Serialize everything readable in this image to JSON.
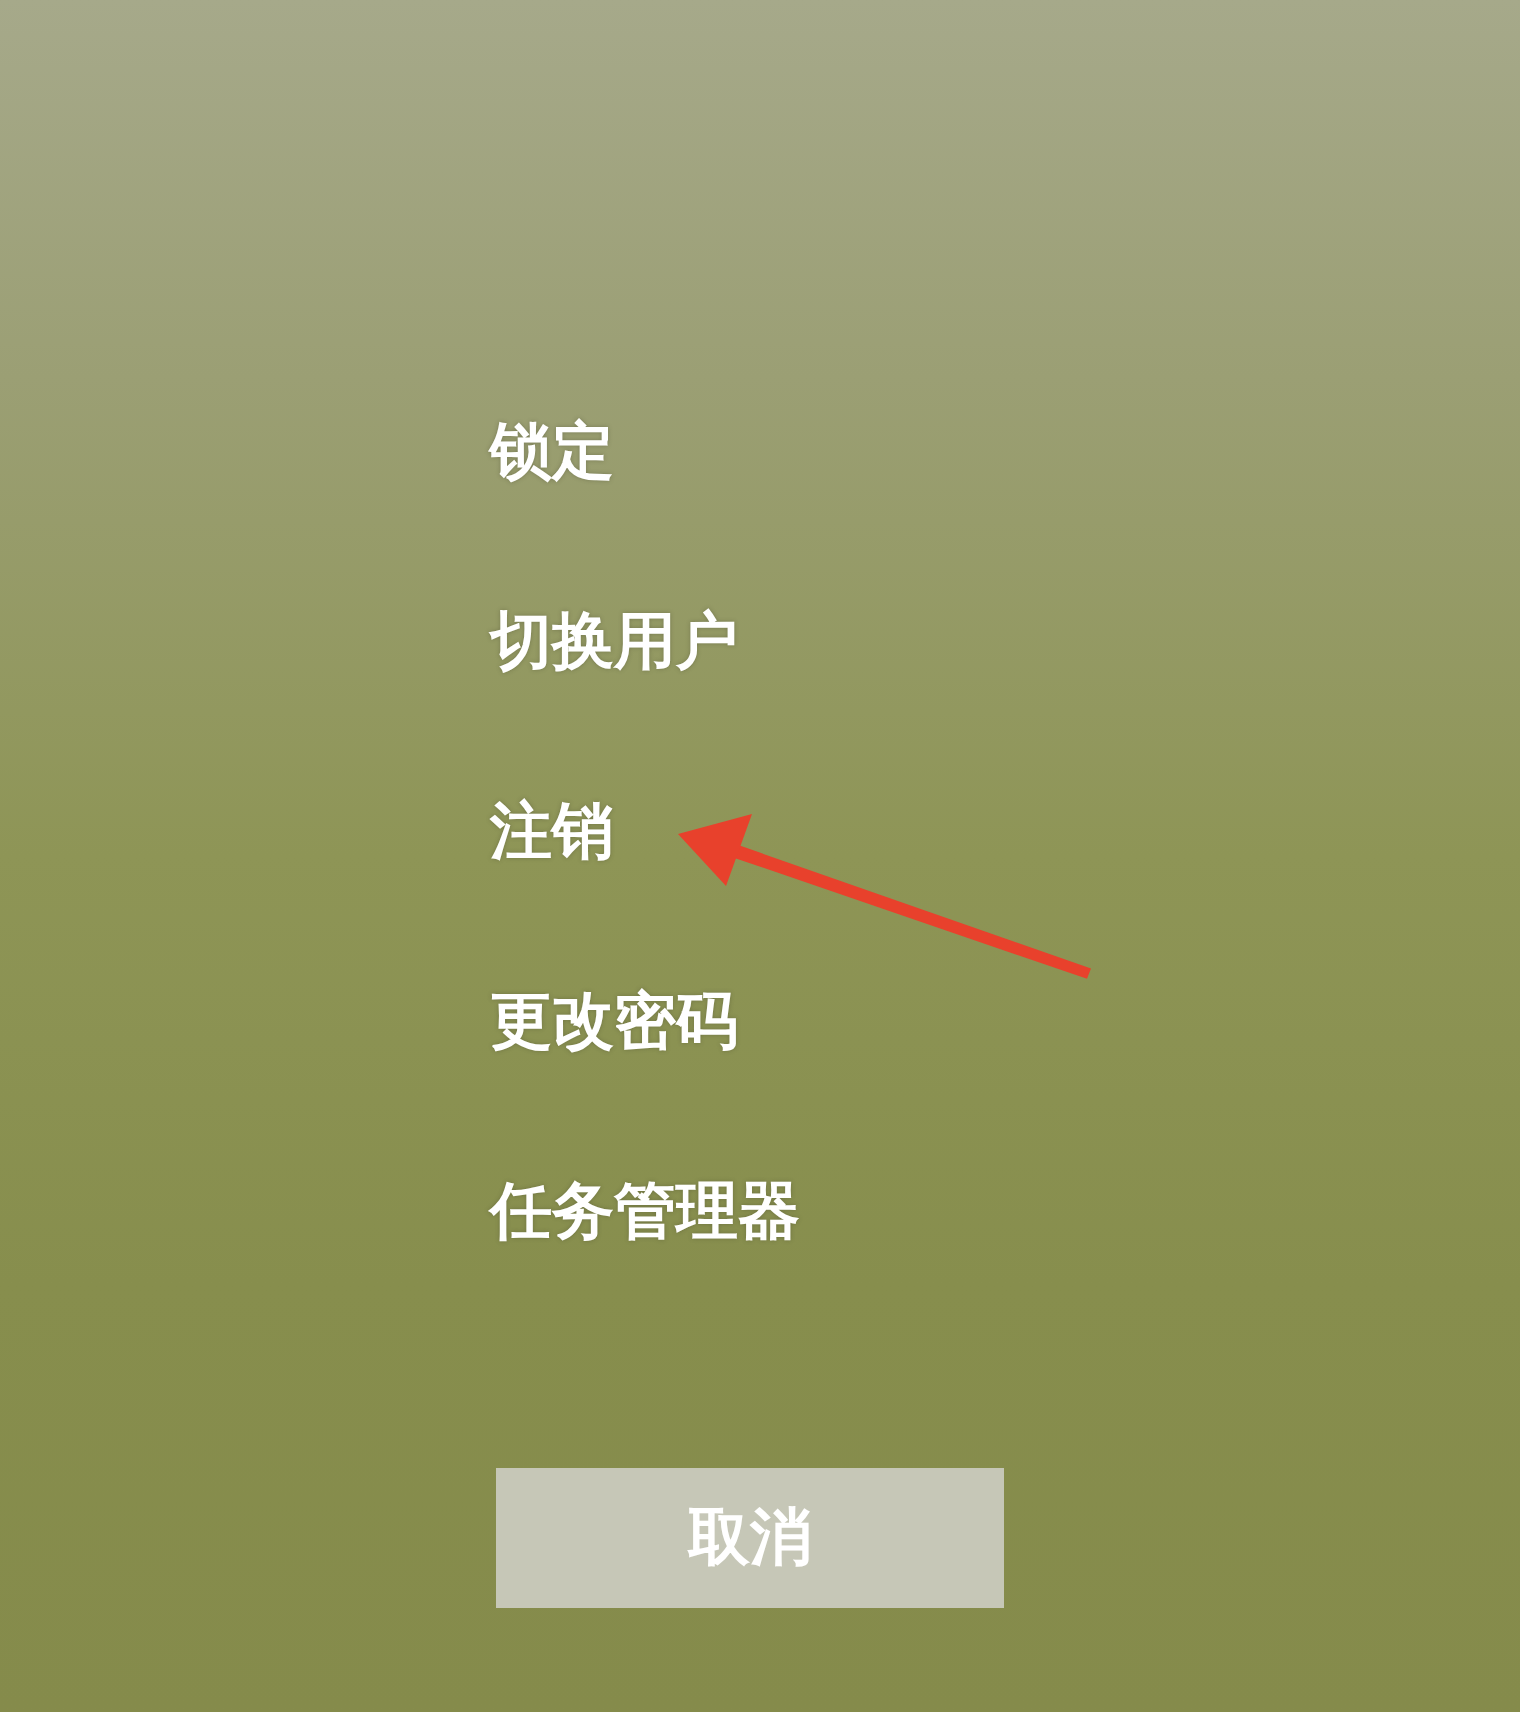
{
  "menu": {
    "items": [
      {
        "label": "锁定",
        "arrow": false
      },
      {
        "label": "切换用户",
        "arrow": false
      },
      {
        "label": "注销",
        "arrow": true
      },
      {
        "label": "更改密码",
        "arrow": false
      },
      {
        "label": "任务管理器",
        "arrow": false
      }
    ]
  },
  "cancel_button": {
    "label": "取消"
  }
}
